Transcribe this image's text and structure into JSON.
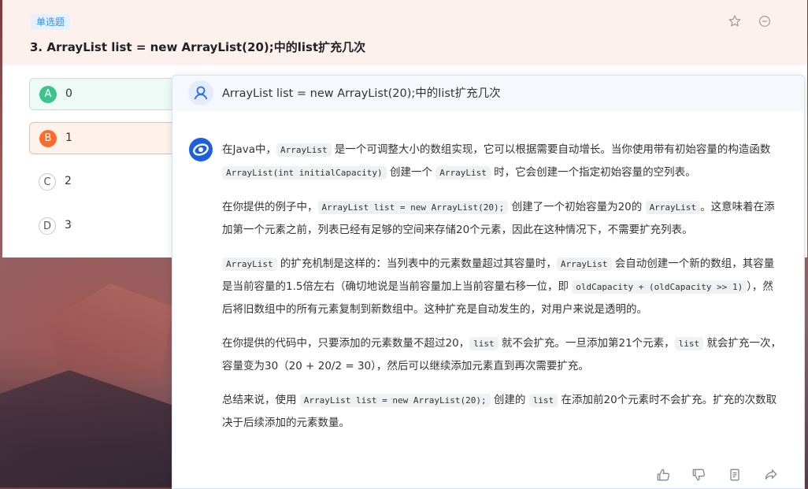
{
  "question": {
    "type_badge": "单选题",
    "title": "3. ArrayList list = new ArrayList(20);中的list扩充几次",
    "options": [
      {
        "letter": "A",
        "text": "0",
        "state": "correct"
      },
      {
        "letter": "B",
        "text": "1",
        "state": "selected-wrong"
      },
      {
        "letter": "C",
        "text": "2",
        "state": "normal"
      },
      {
        "letter": "D",
        "text": "3",
        "state": "normal"
      }
    ],
    "header_icons": [
      "star-icon",
      "minus-circle-icon"
    ]
  },
  "ai": {
    "user_question": "ArrayList list = new ArrayList(20);中的list扩充几次",
    "p1": {
      "t1": "在Java中，",
      "c1": "ArrayList",
      "t2": " 是一个可调整大小的数组实现，它可以根据需要自动增长。当你使用带有初始容量的构造函数 ",
      "c2": "ArrayList(int initialCapacity)",
      "t3": " 创建一个 ",
      "c3": "ArrayList",
      "t4": " 时，它会创建一个指定初始容量的空列表。"
    },
    "p2": {
      "t1": "在你提供的例子中，",
      "c1": "ArrayList list = new ArrayList(20);",
      "t2": " 创建了一个初始容量为20的 ",
      "c2": "ArrayList",
      "t3": "。这意味着在添加第一个元素之前，列表已经有足够的空间来存储20个元素，因此在这种情况下，不需要扩充列表。"
    },
    "p3": {
      "c1": "ArrayList",
      "t1": " 的扩充机制是这样的：当列表中的元素数量超过其容量时，",
      "c2": "ArrayList",
      "t2": " 会自动创建一个新的数组，其容量是当前容量的1.5倍左右（确切地说是当前容量加上当前容量右移一位，即 ",
      "c3": "oldCapacity + (oldCapacity >> 1)",
      "t3": "），然后将旧数组中的所有元素复制到新数组中。这种扩充是自动发生的，对用户来说是透明的。"
    },
    "p4": {
      "t1": "在你提供的代码中，只要添加的元素数量不超过20，",
      "c1": "list",
      "t2": " 就不会扩充。一旦添加第21个元素，",
      "c2": "list",
      "t3": " 就会扩充一次，容量变为30（20 + 20/2 = 30），然后可以继续添加元素直到再次需要扩充。"
    },
    "p5": {
      "t1": "总结来说，使用 ",
      "c1": "ArrayList list = new ArrayList(20);",
      "t2": " 创建的 ",
      "c2": "list",
      "t3": " 在添加前20个元素时不会扩充。扩充的次数取决于后续添加的元素数量。"
    },
    "action_icons": [
      "thumbs-up-icon",
      "thumbs-down-icon",
      "copy-icon",
      "share-icon"
    ]
  },
  "colors": {
    "correct": "#3ec38c",
    "wrong": "#ff6a2d",
    "badge": "#3a8ee6",
    "header_bg": "#fdf1ee"
  }
}
